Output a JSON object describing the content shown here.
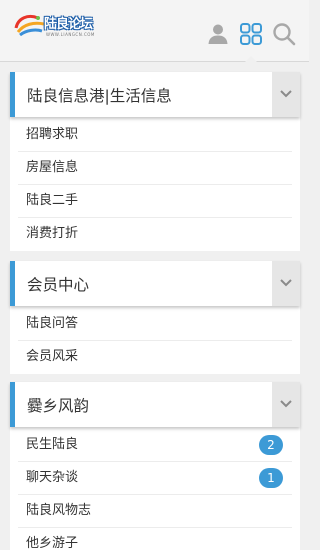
{
  "header": {
    "logo_text": "陆良论坛",
    "logo_tagline": "WWW.LIANGCN.COM"
  },
  "sections": [
    {
      "title": "陆良信息港|生活信息",
      "items": [
        {
          "label": "招聘求职"
        },
        {
          "label": "房屋信息"
        },
        {
          "label": "陆良二手"
        },
        {
          "label": "消费打折"
        }
      ]
    },
    {
      "title": "会员中心",
      "items": [
        {
          "label": "陆良问答"
        },
        {
          "label": "会员风采"
        }
      ]
    },
    {
      "title": "爨乡风韵",
      "items": [
        {
          "label": "民生陆良",
          "badge": "2"
        },
        {
          "label": "聊天杂谈",
          "badge": "1"
        },
        {
          "label": "陆良风物志"
        },
        {
          "label": "他乡游子"
        }
      ]
    }
  ],
  "colors": {
    "accent": "#3c9ad6",
    "icon_gray": "#a8a8a8"
  }
}
